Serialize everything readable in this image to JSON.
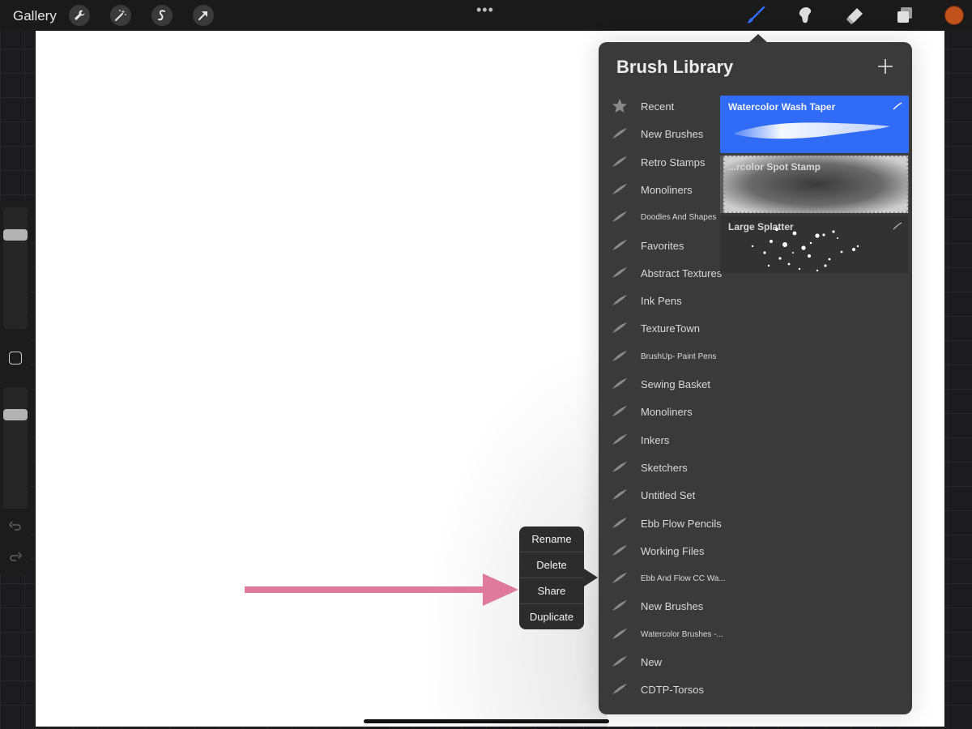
{
  "topbar": {
    "gallery_label": "Gallery",
    "left_tools": [
      "wrench-icon",
      "magic-wand-icon",
      "selection-icon",
      "transform-arrow-icon"
    ],
    "right_tools": [
      "brush-icon",
      "smudge-icon",
      "eraser-icon",
      "layers-icon"
    ],
    "active_tool": "brush-icon",
    "color": "#c2521c",
    "more_label": "•••"
  },
  "brush_library": {
    "title": "Brush Library",
    "sets": [
      {
        "label": "Recent",
        "icon": "star-icon"
      },
      {
        "label": "New Brushes",
        "icon": "brush-set-icon"
      },
      {
        "label": "Retro Stamps",
        "icon": "brush-set-icon"
      },
      {
        "label": "Monoliners",
        "icon": "brush-set-icon"
      },
      {
        "label": "Doodles And Shapes",
        "icon": "brush-set-icon"
      },
      {
        "label": "Favorites",
        "icon": "brush-set-icon"
      },
      {
        "label": "Abstract Textures",
        "icon": "brush-set-icon"
      },
      {
        "label": "Ink Pens",
        "icon": "brush-set-icon"
      },
      {
        "label": "TextureTown",
        "icon": "brush-set-icon"
      },
      {
        "label": "BrushUp- Paint Pens",
        "icon": "brush-set-icon"
      },
      {
        "label": "Sewing Basket",
        "icon": "brush-set-icon"
      },
      {
        "label": "Monoliners",
        "icon": "brush-set-icon"
      },
      {
        "label": "Inkers",
        "icon": "brush-set-icon"
      },
      {
        "label": "Sketchers",
        "icon": "brush-set-icon"
      },
      {
        "label": "Untitled Set",
        "icon": "brush-set-icon"
      },
      {
        "label": "Ebb Flow Pencils",
        "icon": "brush-set-icon"
      },
      {
        "label": "Working Files",
        "icon": "brush-set-icon"
      },
      {
        "label": "Ebb And Flow CC Wa...",
        "icon": "brush-set-icon"
      },
      {
        "label": "New Brushes",
        "icon": "brush-set-icon"
      },
      {
        "label": "Watercolor Brushes -...",
        "icon": "brush-set-icon"
      },
      {
        "label": "New",
        "icon": "brush-set-icon"
      },
      {
        "label": "CDTP-Torsos",
        "icon": "brush-set-icon"
      }
    ],
    "brushes": [
      {
        "name": "Watercolor Wash Taper",
        "selected": true
      },
      {
        "name": "...rcolor Spot Stamp",
        "selected": false
      },
      {
        "name": "Large Splatter",
        "selected": false
      }
    ],
    "selected_color": "#2f6bf5"
  },
  "context_menu": {
    "items": [
      "Rename",
      "Delete",
      "Share",
      "Duplicate"
    ]
  },
  "annotation": {
    "arrow_color": "#e07a9c"
  }
}
